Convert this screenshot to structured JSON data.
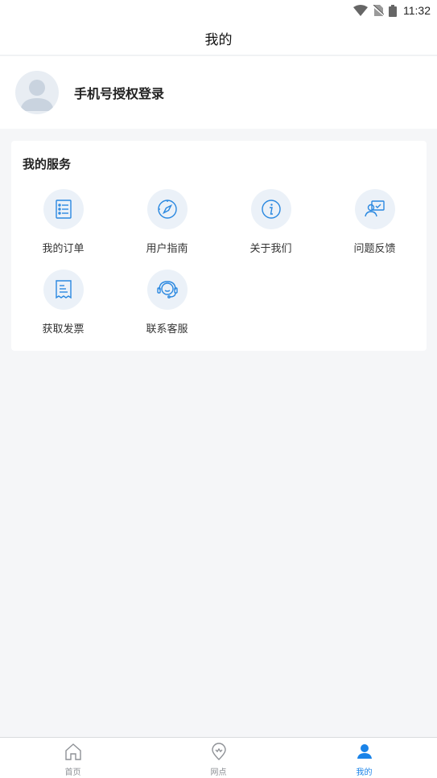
{
  "status_bar": {
    "time": "11:32",
    "icons": [
      "wifi-icon",
      "no-sim-icon",
      "battery-icon"
    ]
  },
  "header": {
    "title": "我的"
  },
  "profile": {
    "avatar_icon": "default-avatar-icon",
    "login_label": "手机号授权登录"
  },
  "services": {
    "title": "我的服务",
    "items": [
      {
        "label": "我的订单",
        "icon": "order-list-icon"
      },
      {
        "label": "用户指南",
        "icon": "compass-icon"
      },
      {
        "label": "关于我们",
        "icon": "info-icon"
      },
      {
        "label": "问题反馈",
        "icon": "feedback-icon"
      },
      {
        "label": "获取发票",
        "icon": "invoice-icon"
      },
      {
        "label": "联系客服",
        "icon": "customer-service-icon"
      }
    ]
  },
  "tab_bar": {
    "tabs": [
      {
        "label": "首页",
        "icon": "home-icon",
        "active": false
      },
      {
        "label": "网点",
        "icon": "location-icon",
        "active": false
      },
      {
        "label": "我的",
        "icon": "user-icon",
        "active": true
      }
    ]
  },
  "colors": {
    "accent": "#1a83e8",
    "icon_bg": "#ebf1f8",
    "page_bg": "#f5f6f8",
    "tab_inactive": "#8e9196"
  }
}
